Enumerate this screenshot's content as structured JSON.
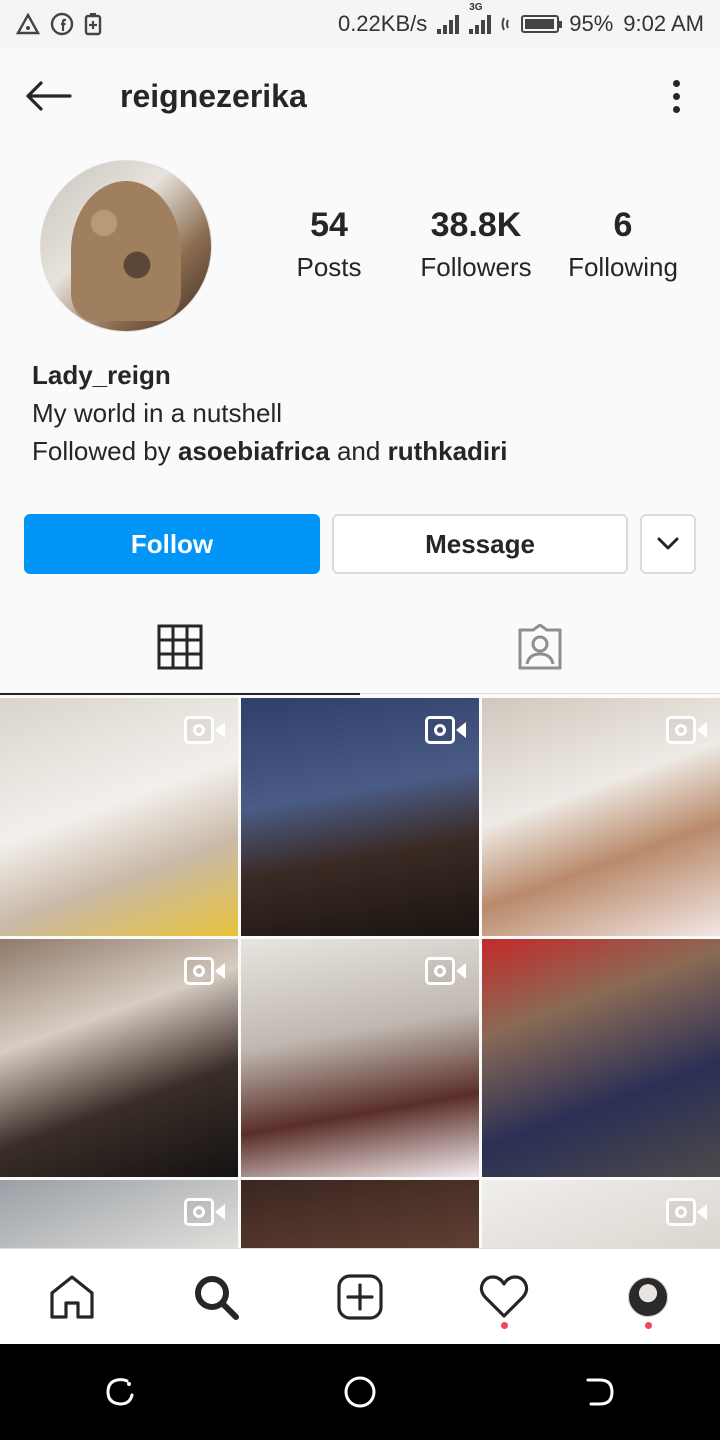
{
  "status_bar": {
    "speed": "0.22KB/s",
    "network": "3G",
    "battery": "95%",
    "battery_level": 0.95,
    "time": "9:02 AM"
  },
  "header": {
    "username": "reignezerika"
  },
  "profile": {
    "stats": [
      {
        "value": "54",
        "label": "Posts"
      },
      {
        "value": "38.8K",
        "label": "Followers"
      },
      {
        "value": "6",
        "label": "Following"
      }
    ],
    "display_name": "Lady_reign",
    "bio": "My world in a nutshell",
    "followed_by_prefix": "Followed by",
    "followed_by_1": "asoebiafrica",
    "followed_by_and": "and",
    "followed_by_2": "ruthkadiri"
  },
  "actions": {
    "follow_label": "Follow",
    "message_label": "Message"
  },
  "grid": {
    "tiles": [
      {
        "bg": "linear-gradient(160deg,#d9d4cc 0%,#f3f0ec 45%,#c9b9a8 70%,#e7c23a 100%)",
        "video": true
      },
      {
        "bg": "linear-gradient(170deg,#2e3f6a 0%,#4a5c86 40%,#3a2a24 65%,#1a1410 100%)",
        "video": true
      },
      {
        "bg": "linear-gradient(160deg,#cfc7bc 0%,#eeeae5 40%,#b98a6a 65%,#f2e6e4 100%)",
        "video": true
      },
      {
        "bg": "linear-gradient(160deg,#8f7a6a 0%,#d8cdc3 35%,#3a2e28 65%,#151212 100%)",
        "video": true
      },
      {
        "bg": "linear-gradient(170deg,#e8e4df 0%,#bfb8b0 40%,#5a2e28 70%,#f4ecee 100%)",
        "video": true
      },
      {
        "bg": "linear-gradient(160deg,#c42a2a 0%,#8a6a55 30%,#2a2f55 65%,#4d4a4a 100%)",
        "video": false
      },
      {
        "bg": "linear-gradient(160deg,#9aa0a6 0%,#e5e2de 50%,#cfc6b0 100%)",
        "video": true
      },
      {
        "bg": "linear-gradient(170deg,#3a2620 0%,#6b4638 50%,#b56a5a 100%)",
        "video": false
      },
      {
        "bg": "linear-gradient(160deg,#f1efec 0%,#d9d4cd 50%,#7a5a45 100%)",
        "video": true
      }
    ]
  },
  "colors": {
    "accent": "#0095f6",
    "notification_dot": "#ed4956"
  },
  "icons": {
    "back": "arrow-left-icon",
    "more": "more-vertical-icon",
    "grid": "grid-icon",
    "tagged": "tagged-icon",
    "home": "home-icon",
    "search": "search-icon",
    "new_post": "add-post-icon",
    "activity": "heart-icon",
    "video": "video-camera-icon"
  }
}
